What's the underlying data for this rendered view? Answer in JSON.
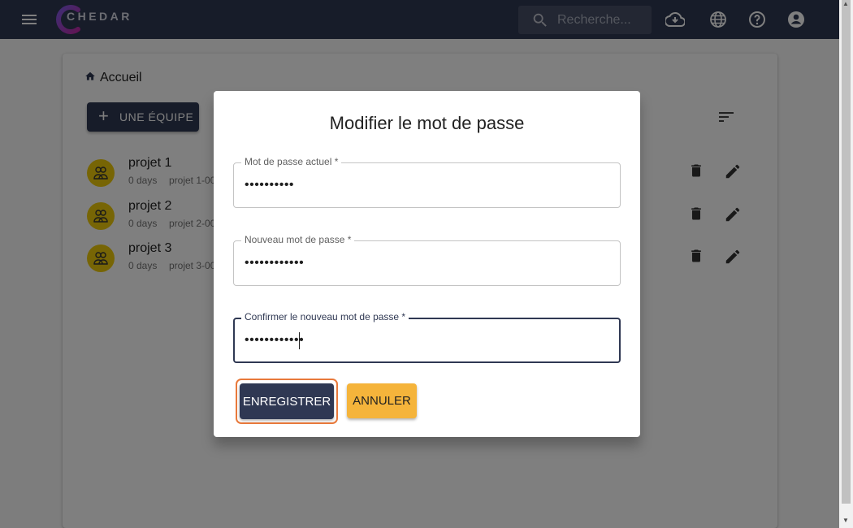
{
  "app": {
    "logo_text": "CHEDAR",
    "colors": {
      "primary": "#2f3853",
      "accent": "#f5b43b",
      "avatar": "#eecb0b",
      "focus_ring": "#e8793b"
    }
  },
  "topbar": {
    "search_placeholder": "Recherche...",
    "icons": [
      "menu-icon",
      "cloud-download-icon",
      "globe-icon",
      "help-icon",
      "account-icon"
    ]
  },
  "page": {
    "breadcrumb": "Accueil",
    "add_team_label": "UNE ÉQUIPE",
    "projects": [
      {
        "title": "projet 1",
        "days": "0 days",
        "id": "projet 1-00"
      },
      {
        "title": "projet 2",
        "days": "0 days",
        "id": "projet 2-00"
      },
      {
        "title": "projet 3",
        "days": "0 days",
        "id": "projet 3-00"
      }
    ]
  },
  "dialog": {
    "title": "Modifier le mot de passe",
    "fields": [
      {
        "label": "Mot de passe actuel *",
        "value": "••••••••••"
      },
      {
        "label": "Nouveau mot de passe *",
        "value": "••••••••••••"
      },
      {
        "label": "Confirmer le nouveau mot de passe *",
        "value": "••••••••••••"
      }
    ],
    "save_label": "ENREGISTRER",
    "cancel_label": "ANNULER"
  }
}
